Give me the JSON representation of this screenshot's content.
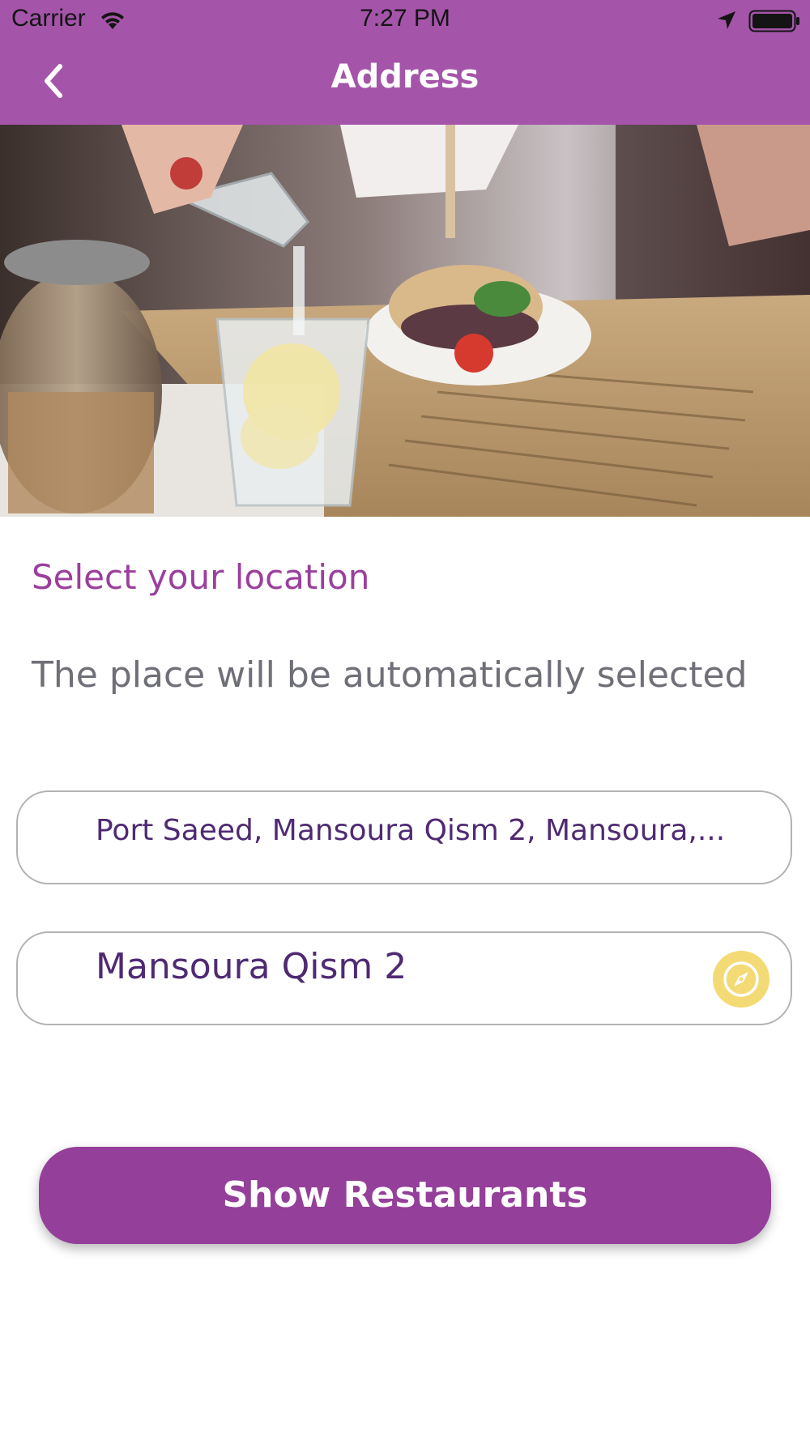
{
  "status_bar": {
    "carrier": "Carrier",
    "time": "7:27 PM",
    "icons": [
      "wifi-icon",
      "location-arrow-icon",
      "battery-icon"
    ]
  },
  "nav_bar": {
    "title": "Address",
    "back_icon": "chevron-left-icon"
  },
  "hero": {
    "image": "restaurant-table-photo"
  },
  "location": {
    "title": "Select your location",
    "subtitle": "The place will be automatically selected",
    "address_value": "Port Saeed, Mansoura Qism 2, Mansoura,...",
    "area_value": "Mansoura Qism 2",
    "locate_icon": "compass-icon"
  },
  "actions": {
    "show_restaurants_label": "Show Restaurants"
  },
  "colors": {
    "brand": "#a455a9",
    "button": "#943f99",
    "title": "#9b3f9d",
    "field_text": "#4f2a73",
    "compass_bg": "#f3da74"
  }
}
